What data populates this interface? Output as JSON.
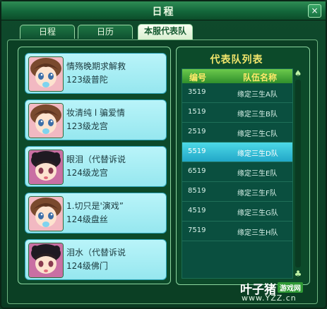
{
  "window": {
    "title": "日程",
    "close_label": "×"
  },
  "tabs": [
    {
      "label": "日程"
    },
    {
      "label": "日历"
    },
    {
      "label": "本服代表队"
    }
  ],
  "characters": [
    {
      "name": "情殇晚期求解救",
      "level": "123级普陀",
      "avatar": "girl-pink-hair-icon"
    },
    {
      "name": "妆清纯 l 骗爱情",
      "level": "123级龙宫",
      "avatar": "girl-pink-hair-icon"
    },
    {
      "name": "眼泪（代替诉说",
      "level": "124级龙宫",
      "avatar": "girl-black-hat-icon"
    },
    {
      "name": "1.切只是'演戏”",
      "level": "124级盘丝",
      "avatar": "girl-pink-hair-icon"
    },
    {
      "name": "泪水（代替诉说",
      "level": "124级佛门",
      "avatar": "girl-black-hat-icon"
    }
  ],
  "team_list": {
    "title": "代表队列表",
    "headers": {
      "id": "编号",
      "name": "队伍名称"
    },
    "rows": [
      {
        "id": "3519",
        "name": "缘定三生A队"
      },
      {
        "id": "1519",
        "name": "缘定三生B队"
      },
      {
        "id": "2519",
        "name": "缘定三生C队"
      },
      {
        "id": "5519",
        "name": "缘定三生D队"
      },
      {
        "id": "6519",
        "name": "缘定三生E队"
      },
      {
        "id": "8519",
        "name": "缘定三生F队"
      },
      {
        "id": "4519",
        "name": "缘定三生G队"
      },
      {
        "id": "7519",
        "name": "缘定三生H队"
      }
    ],
    "selected_index": 3
  },
  "watermark": {
    "brand": "叶子猪",
    "badge": "游戏网",
    "url": "www.YZZ.cn"
  },
  "colors": {
    "title_yellow": "#f0e56b",
    "selection_cyan": "#2bb3cf",
    "card_cyan": "#a7eef4",
    "frame_green": "#0c4a2a"
  }
}
